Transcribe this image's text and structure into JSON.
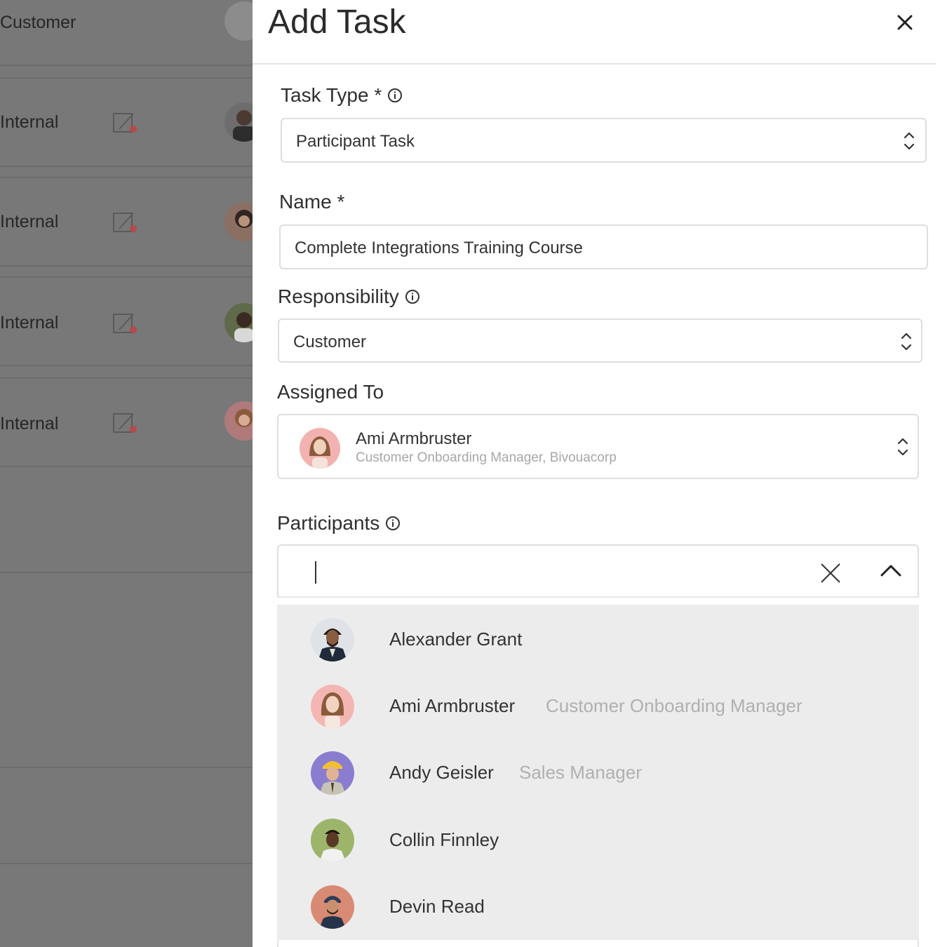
{
  "background": {
    "rows": [
      {
        "label": "Customer"
      },
      {
        "label": "Internal"
      },
      {
        "label": "Internal"
      },
      {
        "label": "Internal"
      },
      {
        "label": "Internal"
      }
    ],
    "overlay_color": "#787878"
  },
  "modal": {
    "title": "Add Task",
    "task_type": {
      "label": "Task Type *",
      "value": "Participant Task"
    },
    "name": {
      "label": "Name *",
      "value": "Complete Integrations Training Course"
    },
    "responsibility": {
      "label": "Responsibility",
      "value": "Customer"
    },
    "assigned_to": {
      "label": "Assigned To",
      "name": "Ami Armbruster",
      "subtitle": "Customer Onboarding Manager, Bivouacorp"
    },
    "participants": {
      "label": "Participants",
      "search_value": "",
      "options": [
        {
          "name": "Alexander Grant",
          "role": ""
        },
        {
          "name": "Ami Armbruster",
          "role": "Customer Onboarding Manager"
        },
        {
          "name": "Andy Geisler",
          "role": "Sales Manager"
        },
        {
          "name": "Collin Finnley",
          "role": ""
        },
        {
          "name": "Devin Read",
          "role": ""
        }
      ]
    }
  },
  "colors": {
    "panel_bg": "#ffffff",
    "dropdown_bg": "#ececec",
    "muted_text": "#b0b0b0"
  },
  "icons": [
    "close-icon",
    "info-icon",
    "chevron-updown-icon",
    "clear-icon",
    "chevron-up-icon",
    "task-edit-icon"
  ]
}
